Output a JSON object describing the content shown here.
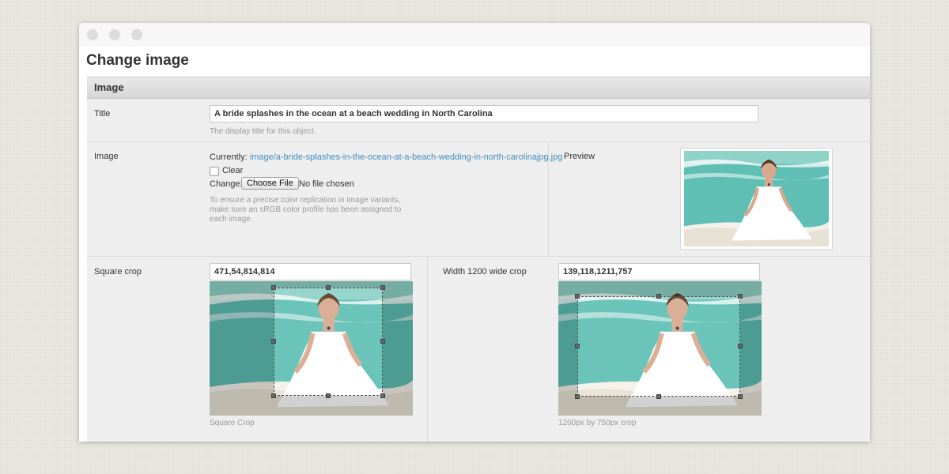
{
  "page": {
    "title": "Change image"
  },
  "fieldset": {
    "legend": "Image"
  },
  "title_field": {
    "label": "Title",
    "value": "A bride splashes in the ocean at a beach wedding in North Carolina",
    "help": "The display title for this object."
  },
  "image_field": {
    "label": "Image",
    "currently_label": "Currently:",
    "currently_link": "image/a-bride-splashes-in-the-ocean-at-a-beach-wedding-in-north-carolinajpg.jpg",
    "clear_label": "Clear",
    "change_label": "Change:",
    "choose_button": "Choose File",
    "no_file": "No file chosen",
    "help_lines": [
      "To ensure a precise color replication in image variants,",
      "make sure an sRGB color profile has been assigned to",
      "each image."
    ]
  },
  "preview": {
    "label": "Preview"
  },
  "square_crop": {
    "label": "Square crop",
    "value": "471,54,814,814",
    "help": "Square Crop"
  },
  "wide_crop": {
    "label": "Width 1200 wide crop",
    "value": "139,118,1211,757",
    "help": "1200px by 750px crop"
  },
  "colors": {
    "link": "#3d8fc0",
    "sea": "#5fbfb4",
    "foam": "#ffffff",
    "sand": "#e8e2d4"
  }
}
